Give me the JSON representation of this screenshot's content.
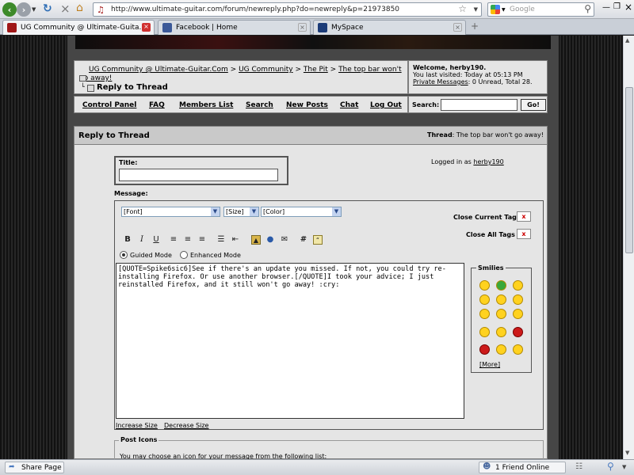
{
  "browser": {
    "url": "http://www.ultimate-guitar.com/forum/newreply.php?do=newreply&p=21973850",
    "search_placeholder": "Google",
    "tabs": [
      {
        "label": "UG Community @ Ultimate-Guita..."
      },
      {
        "label": "Facebook | Home"
      },
      {
        "label": "MySpace"
      }
    ],
    "status": {
      "share": "Share Page",
      "friends": "1 Friend Online"
    }
  },
  "breadcrumb": {
    "items": [
      "UG Community @ Ultimate-Guitar.Com",
      "UG Community",
      "The Pit",
      "The top bar won't go away!"
    ],
    "sep": ">",
    "current": "Reply to Thread"
  },
  "welcome": {
    "greeting": "Welcome, herby190.",
    "last_visited": "You last visited: Today at 05:13 PM",
    "pm_link": "Private Messages",
    "pm_text": ": 0 Unread, Total 28."
  },
  "nav": {
    "items": [
      "Control Panel",
      "FAQ",
      "Members List",
      "Search",
      "New Posts",
      "Chat",
      "Log Out"
    ],
    "search_label": "Search:",
    "go": "Go!"
  },
  "panel": {
    "title": "Reply to Thread",
    "thread_label": "Thread",
    "thread_name": ": The top bar won't go away!",
    "title_label": "Title:",
    "logged_in_prefix": "Logged in as",
    "username": "herby190",
    "message_label": "Message:",
    "font": "[Font]",
    "size": "[Size]",
    "color": "[Color]",
    "close_current": "Close Current Tag",
    "close_all": "Close All Tags",
    "x": "x",
    "guided_mode": "Guided Mode",
    "enhanced_mode": "Enhanced Mode",
    "message_text": "[QUOTE=Spike6sic6]See if there's an update you missed. If not, you could try re-installing Firefox. Or use another browser.[/QUOTE]I took your advice; I just reinstalled Firefox, and it still won't go away! :cry:",
    "smilies_title": "Smilies",
    "more": "[More]",
    "increase": "Increase Size",
    "decrease": "Decrease Size",
    "post_icons": "Post Icons",
    "post_icons_text": "You may choose an icon for your message from the following list:"
  },
  "colors": {
    "accent_red": "#cc0000",
    "panel_bg": "#e5e5e5",
    "header_bg": "#c9c9c9"
  }
}
